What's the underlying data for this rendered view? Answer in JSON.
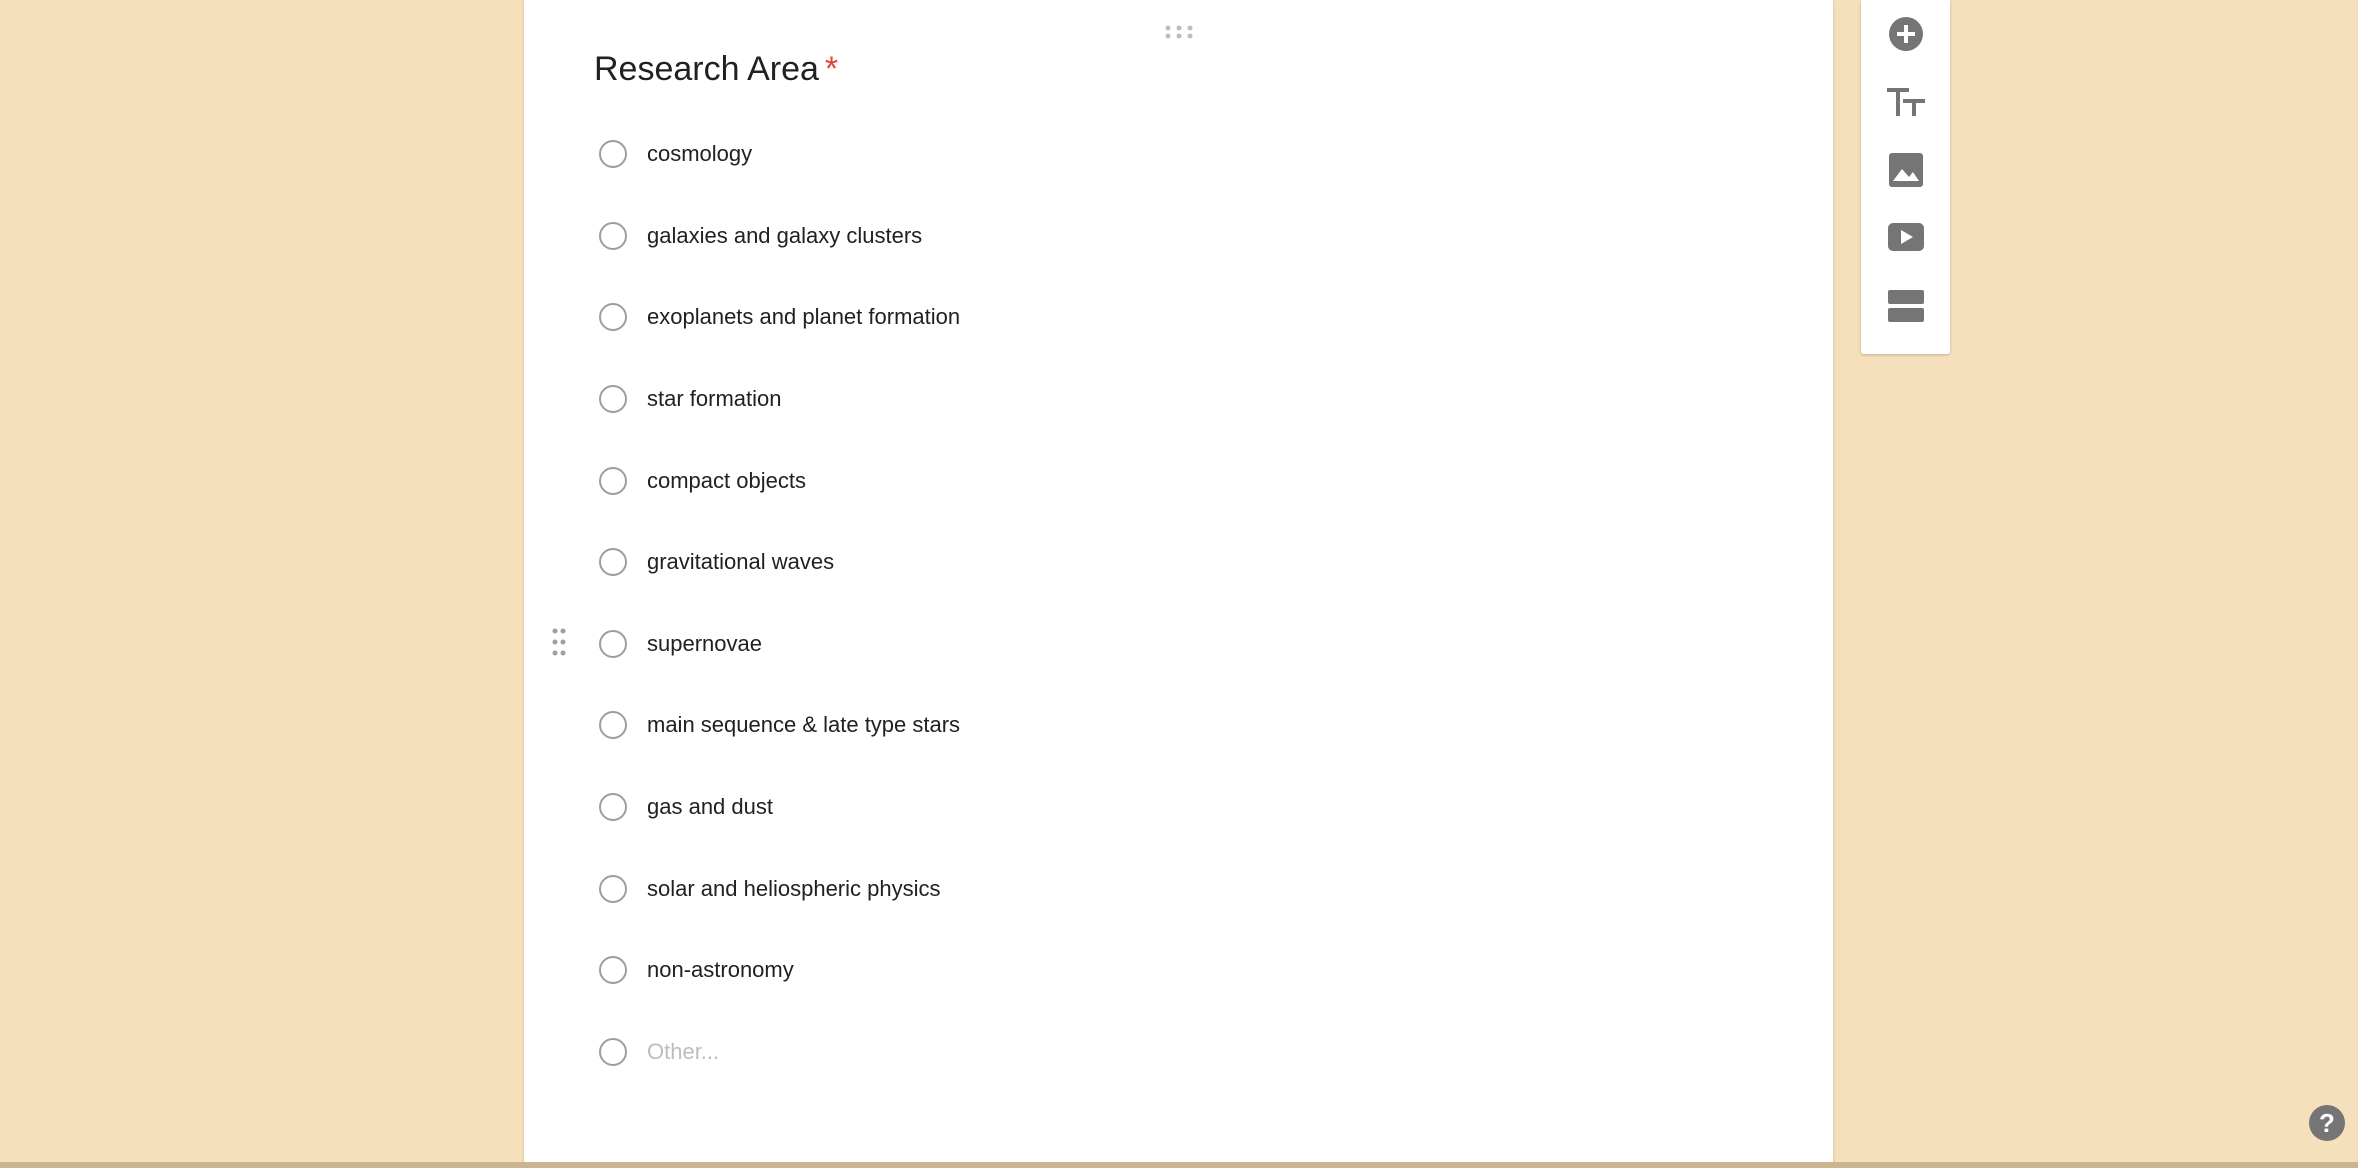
{
  "question": {
    "title": "Research Area",
    "required_mark": "*",
    "options": [
      "cosmology",
      "galaxies and galaxy clusters",
      "exoplanets and planet formation",
      "star formation",
      "compact objects",
      "gravitational waves",
      "supernovae",
      "main sequence & late type stars",
      "gas and dust",
      "solar and heliospheric physics",
      "non-astronomy"
    ],
    "other_placeholder": "Other..."
  },
  "toolbar": {
    "items": [
      {
        "icon": "add-circle-icon"
      },
      {
        "icon": "title-text-icon"
      },
      {
        "icon": "image-icon"
      },
      {
        "icon": "video-icon"
      },
      {
        "icon": "section-icon"
      }
    ]
  },
  "help": {
    "label": "?"
  },
  "colors": {
    "background": "#f6e0bb",
    "card": "#ffffff",
    "required": "#db4437",
    "icon": "#757575"
  }
}
